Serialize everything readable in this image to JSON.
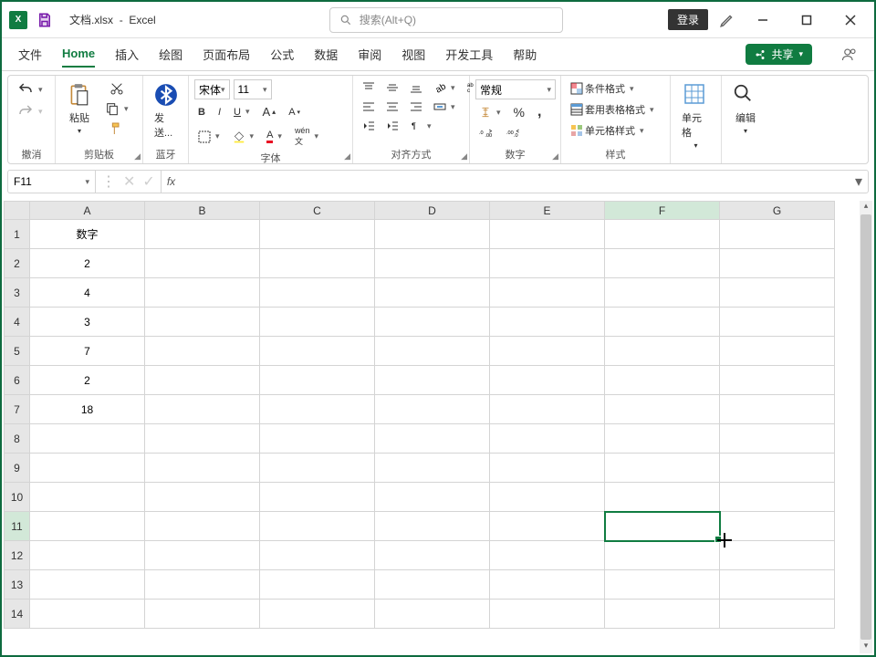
{
  "title": {
    "filename": "文档.xlsx",
    "separator": "-",
    "app": "Excel"
  },
  "search": {
    "placeholder": "搜索(Alt+Q)"
  },
  "login": "登录",
  "tabs": {
    "file": "文件",
    "home": "Home",
    "insert": "插入",
    "draw": "绘图",
    "layout": "页面布局",
    "formulas": "公式",
    "data": "数据",
    "review": "审阅",
    "view": "视图",
    "dev": "开发工具",
    "help": "帮助"
  },
  "share": "共享",
  "ribbon": {
    "undo_group": "撤消",
    "clipboard": {
      "paste": "粘贴",
      "label": "剪贴板"
    },
    "bluetooth": {
      "send": "发送...",
      "label": "蓝牙"
    },
    "font": {
      "name": "宋体",
      "size": "11",
      "label": "字体"
    },
    "align": {
      "label": "对齐方式"
    },
    "number": {
      "format": "常规",
      "label": "数字"
    },
    "styles": {
      "cond": "条件格式",
      "table": "套用表格格式",
      "cell": "单元格样式",
      "label": "样式"
    },
    "cells": {
      "label": "单元格"
    },
    "editing": {
      "label": "编辑"
    }
  },
  "namebox": "F11",
  "columns": [
    "A",
    "B",
    "C",
    "D",
    "E",
    "F",
    "G"
  ],
  "rows": [
    "1",
    "2",
    "3",
    "4",
    "5",
    "6",
    "7",
    "8",
    "9",
    "10",
    "11",
    "12",
    "13",
    "14"
  ],
  "cells": {
    "A1": "数字",
    "A2": "2",
    "A3": "4",
    "A4": "3",
    "A5": "7",
    "A6": "2",
    "A7": "18"
  },
  "active": {
    "col": "F",
    "row": "11"
  },
  "chart_data": {
    "type": "table",
    "title": "数字",
    "values": [
      2,
      4,
      3,
      7,
      2,
      18
    ]
  }
}
